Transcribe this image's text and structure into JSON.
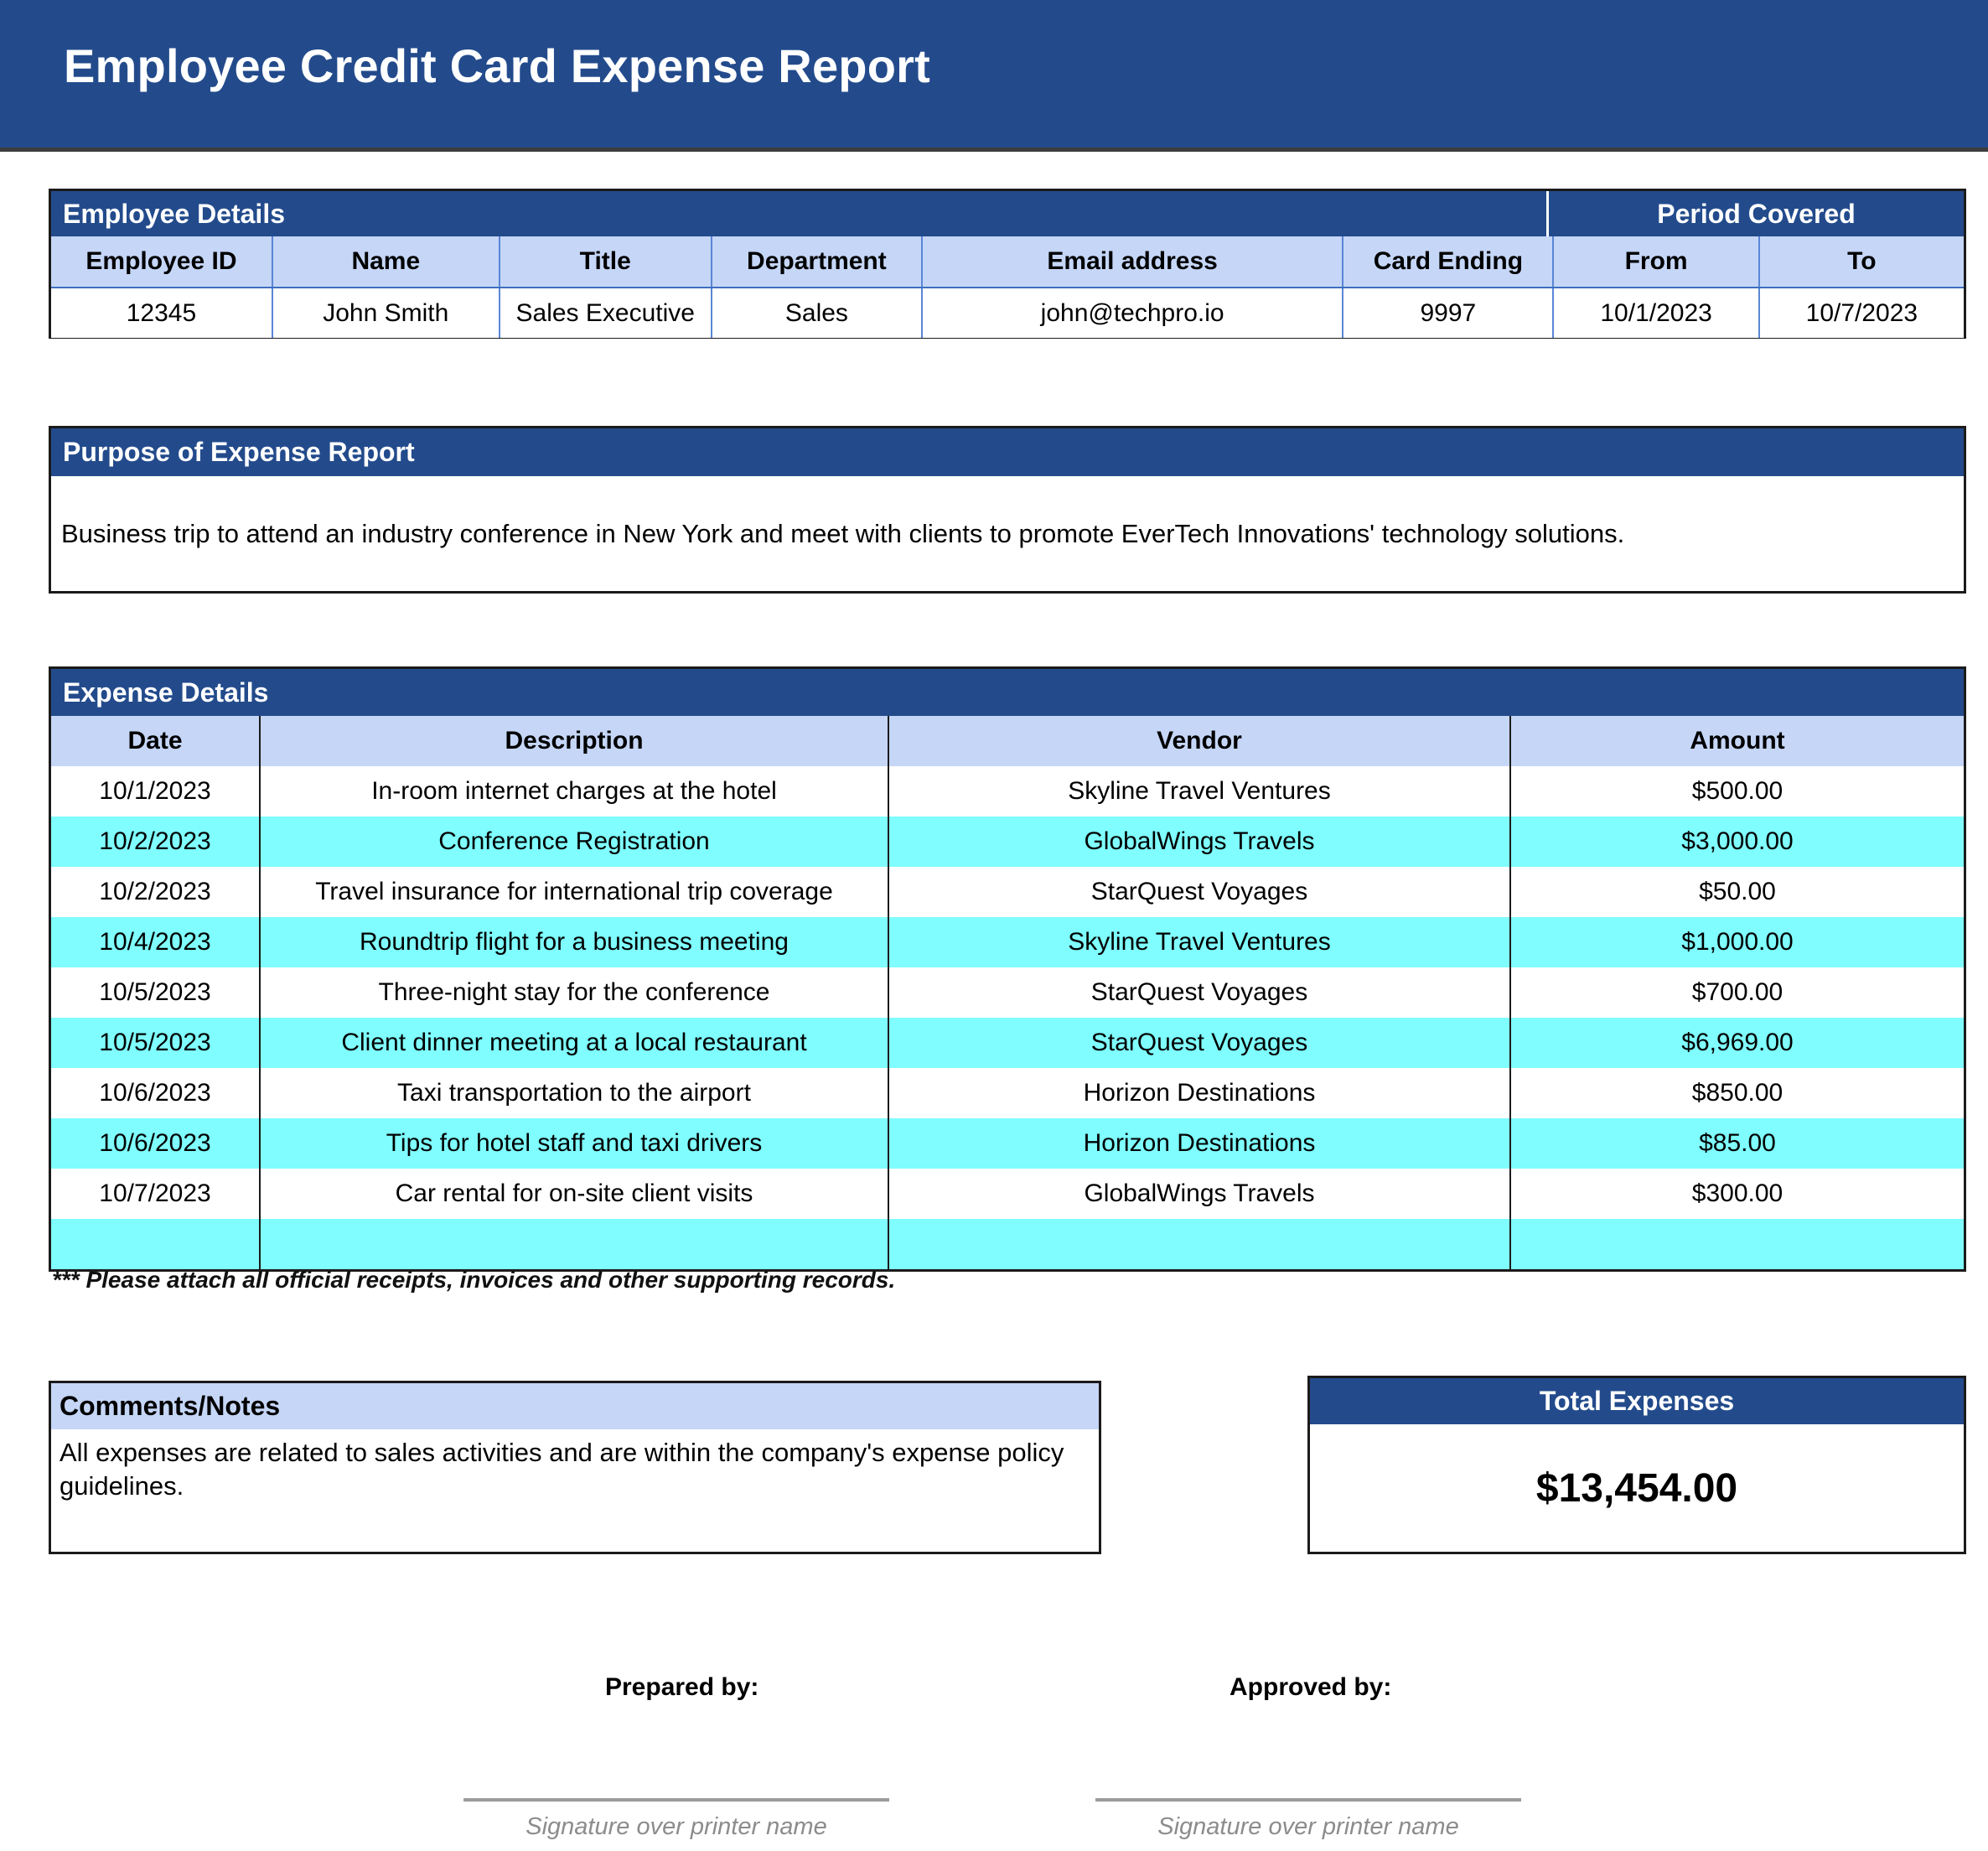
{
  "document": {
    "title": "Employee Credit Card Expense Report",
    "colors": {
      "header_blue": "#234b8c",
      "light_blue": "#c5d6f7",
      "cyan_row": "#7ffdff",
      "border_dark": "#1b1b1b",
      "grid_blue": "#5a86d6"
    }
  },
  "employee_details": {
    "section_title": "Employee Details",
    "period_title": "Period Covered",
    "columns": [
      "Employee ID",
      "Name",
      "Title",
      "Department",
      "Email address",
      "Card Ending",
      "From",
      "To"
    ],
    "values": {
      "employee_id": "12345",
      "name": "John Smith",
      "title": "Sales Executive",
      "department": "Sales",
      "email": "john@techpro.io",
      "card_ending": "9997",
      "from": "10/1/2023",
      "to": "10/7/2023"
    }
  },
  "purpose": {
    "section_title": "Purpose of Expense Report",
    "text": "Business trip to attend an industry conference in New York and meet with clients to promote EverTech Innovations' technology solutions."
  },
  "expense_details": {
    "section_title": "Expense Details",
    "columns": [
      "Date",
      "Description",
      "Vendor",
      "Amount"
    ],
    "rows": [
      {
        "date": "10/1/2023",
        "description": "In-room internet charges at the hotel",
        "vendor": "Skyline Travel Ventures",
        "amount": "$500.00"
      },
      {
        "date": "10/2/2023",
        "description": "Conference Registration",
        "vendor": "GlobalWings Travels",
        "amount": "$3,000.00"
      },
      {
        "date": "10/2/2023",
        "description": "Travel insurance for international trip coverage",
        "vendor": "StarQuest Voyages",
        "amount": "$50.00"
      },
      {
        "date": "10/4/2023",
        "description": "Roundtrip flight for a business meeting",
        "vendor": "Skyline Travel Ventures",
        "amount": "$1,000.00"
      },
      {
        "date": "10/5/2023",
        "description": "Three-night stay for the conference",
        "vendor": "StarQuest Voyages",
        "amount": "$700.00"
      },
      {
        "date": "10/5/2023",
        "description": "Client dinner meeting at a local restaurant",
        "vendor": "StarQuest Voyages",
        "amount": "$6,969.00"
      },
      {
        "date": "10/6/2023",
        "description": "Taxi transportation to the airport",
        "vendor": "Horizon Destinations",
        "amount": "$850.00"
      },
      {
        "date": "10/6/2023",
        "description": "Tips for hotel staff and taxi drivers",
        "vendor": "Horizon Destinations",
        "amount": "$85.00"
      },
      {
        "date": "10/7/2023",
        "description": "Car rental for on-site client visits",
        "vendor": "GlobalWings Travels",
        "amount": "$300.00"
      },
      {
        "date": "",
        "description": "",
        "vendor": "",
        "amount": ""
      }
    ],
    "attachment_note": "*** Please attach all official receipts, invoices and other supporting records."
  },
  "comments": {
    "section_title": "Comments/Notes",
    "text": "All expenses are related to sales activities and are within the company's expense policy guidelines."
  },
  "total": {
    "label": "Total Expenses",
    "value": "$13,454.00"
  },
  "signatures": {
    "prepared_label": "Prepared by:",
    "approved_label": "Approved by:",
    "prepared_caption": "Signature over printer name",
    "approved_caption": "Signature over printer name"
  }
}
